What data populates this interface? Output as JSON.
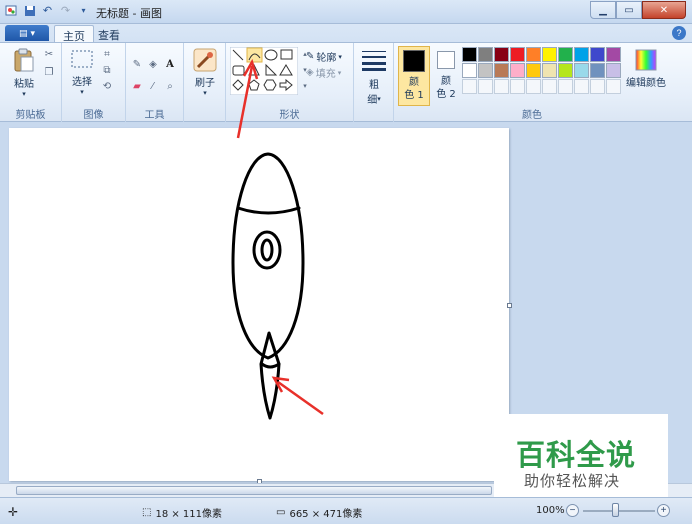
{
  "window": {
    "title": "无标题 - 画图"
  },
  "tabs": {
    "home": "主页",
    "view": "查看"
  },
  "ribbon": {
    "clipboard": {
      "label": "剪贴板",
      "paste": "粘贴"
    },
    "image": {
      "label": "图像",
      "select": "选择"
    },
    "tools": {
      "label": "工具"
    },
    "brushes": {
      "label": "刷子"
    },
    "shapes": {
      "label": "形状",
      "outline": "轮廓",
      "fill": "填充"
    },
    "size": {
      "label1": "粗",
      "label2": "细"
    },
    "colors": {
      "label": "颜色",
      "color1_a": "颜",
      "color1_b": "色 1",
      "color2_a": "颜",
      "color2_b": "色 2",
      "edit": "编辑颜色",
      "accent_selected": "#fde7a1",
      "row1": [
        "#000000",
        "#7f7f7f",
        "#880015",
        "#ed1c24",
        "#ff7f27",
        "#fff200",
        "#22b14c",
        "#00a2e8",
        "#3f48cc",
        "#a349a4"
      ],
      "row2": [
        "#ffffff",
        "#c3c3c3",
        "#b97a57",
        "#ffaec9",
        "#ffc90e",
        "#efe4b0",
        "#b5e61d",
        "#99d9ea",
        "#7092be",
        "#c8bfe7"
      ]
    }
  },
  "status": {
    "selection_size": "18 × 111像素",
    "image_size": "665 × 471像素",
    "zoom": "100%"
  },
  "watermark": {
    "title": "百科全说",
    "subtitle": "助你轻松解决"
  },
  "annotations": {
    "arrow_color": "#e8302a"
  }
}
